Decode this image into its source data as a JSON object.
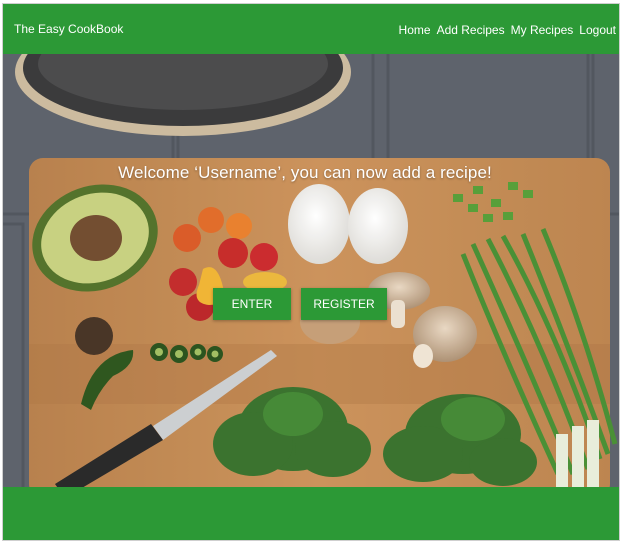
{
  "navbar": {
    "brand": "The Easy CookBook",
    "links": [
      {
        "label": "Home"
      },
      {
        "label": "Add Recipes"
      },
      {
        "label": "My Recipes"
      },
      {
        "label": "Logout"
      }
    ]
  },
  "hero": {
    "welcome_text": "Welcome ‘Username’, you can now add a recipe!",
    "enter_label": "ENTER",
    "register_label": "REGISTER"
  },
  "colors": {
    "brand_green": "#2c9936",
    "text": "#ffffff"
  }
}
